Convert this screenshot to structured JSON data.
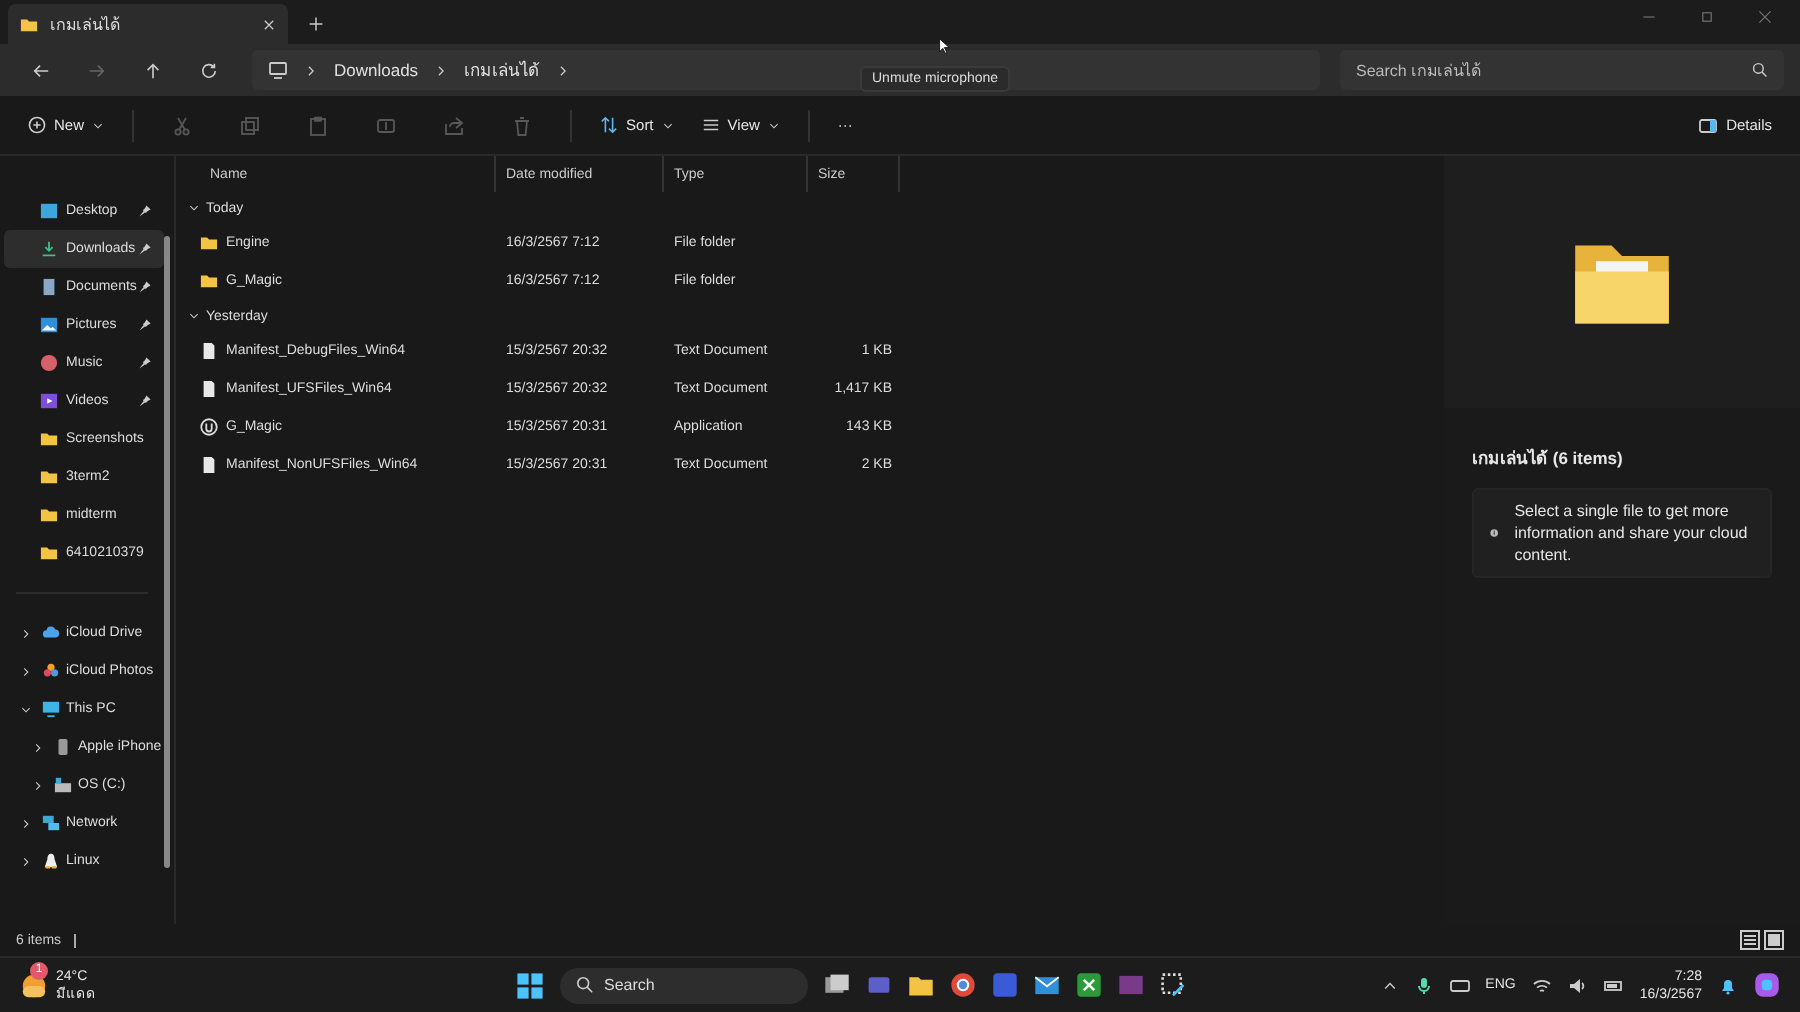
{
  "tabs": [
    {
      "label": "เกมเล่นได้",
      "selected": true
    }
  ],
  "tooltip": "Unmute microphone",
  "breadcrumb": [
    "Downloads",
    "เกมเล่นได้"
  ],
  "search": {
    "placeholder": "Search เกมเล่นได้"
  },
  "toolbar": {
    "new": "New",
    "actions": [
      {
        "kind": "cut",
        "disabled": true
      },
      {
        "kind": "copy",
        "disabled": true
      },
      {
        "kind": "paste",
        "disabled": true
      },
      {
        "kind": "rename",
        "disabled": true
      },
      {
        "kind": "share",
        "disabled": true
      },
      {
        "kind": "delete",
        "disabled": true
      }
    ],
    "sort": "Sort",
    "view": "View",
    "more": "···",
    "details": "Details"
  },
  "sidebar": {
    "quick": [
      {
        "label": "Desktop",
        "kind": "desktop",
        "pinned": true,
        "selected": false
      },
      {
        "label": "Downloads",
        "kind": "download",
        "pinned": true,
        "selected": true
      },
      {
        "label": "Documents",
        "kind": "document",
        "pinned": true,
        "selected": false
      },
      {
        "label": "Pictures",
        "kind": "picture",
        "pinned": true,
        "selected": false
      },
      {
        "label": "Music",
        "kind": "music",
        "pinned": true,
        "selected": false
      },
      {
        "label": "Videos",
        "kind": "video",
        "pinned": true,
        "selected": false
      },
      {
        "label": "Screenshots",
        "kind": "folder",
        "pinned": false,
        "selected": false
      },
      {
        "label": "3term2",
        "kind": "folder",
        "pinned": false,
        "selected": false
      },
      {
        "label": "midterm",
        "kind": "folder",
        "pinned": false,
        "selected": false
      },
      {
        "label": "6410210379",
        "kind": "folder",
        "pinned": false,
        "selected": false
      }
    ],
    "tree": [
      {
        "label": "iCloud Drive",
        "kind": "cloud",
        "expanded": false
      },
      {
        "label": "iCloud Photos",
        "kind": "photos",
        "expanded": false
      },
      {
        "label": "This PC",
        "kind": "pc",
        "expanded": true,
        "children": [
          {
            "label": "Apple iPhone",
            "kind": "phone",
            "expanded": false
          },
          {
            "label": "OS (C:)",
            "kind": "drive",
            "expanded": false
          }
        ]
      },
      {
        "label": "Network",
        "kind": "network",
        "expanded": false
      },
      {
        "label": "Linux",
        "kind": "linux",
        "expanded": false
      }
    ]
  },
  "columns": [
    "Name",
    "Date modified",
    "Type",
    "Size"
  ],
  "groups": [
    {
      "label": "Today",
      "expanded": true,
      "files": [
        {
          "name": "Engine",
          "kind": "folder",
          "date": "16/3/2567 7:12",
          "type": "File folder"
        },
        {
          "name": "G_Magic",
          "kind": "folder",
          "date": "16/3/2567 7:12",
          "type": "File folder"
        }
      ]
    },
    {
      "label": "Yesterday",
      "expanded": true,
      "files": [
        {
          "name": "Manifest_DebugFiles_Win64",
          "kind": "text",
          "date": "15/3/2567 20:32",
          "type": "Text Document",
          "size": "1 KB"
        },
        {
          "name": "Manifest_UFSFiles_Win64",
          "kind": "text",
          "date": "15/3/2567 20:32",
          "type": "Text Document",
          "size": "1,417 KB"
        },
        {
          "name": "G_Magic",
          "kind": "app",
          "date": "15/3/2567 20:31",
          "type": "Application",
          "size": "143 KB"
        },
        {
          "name": "Manifest_NonUFSFiles_Win64",
          "kind": "text",
          "date": "15/3/2567 20:31",
          "type": "Text Document",
          "size": "2 KB"
        }
      ]
    }
  ],
  "details": {
    "title": "เกมเล่นได้ (6 items)",
    "message": "Select a single file to get more information and share your cloud content."
  },
  "status": "6 items",
  "taskbar": {
    "weather": {
      "temp": "24°C",
      "condition": "มีแดด",
      "badge": "1"
    },
    "search": "Search",
    "language": "ENG",
    "time": "7:28",
    "date": "16/3/2567"
  }
}
